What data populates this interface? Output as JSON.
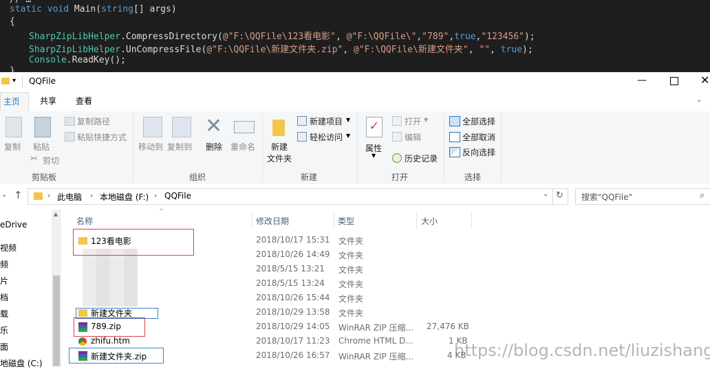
{
  "code": {
    "lines": [
      "static void Main(string[] args)",
      "{",
      "SharpZipLibHelper.CompressDirectory(@\"F:\\QQFile\\123看电影\", @\"F:\\QQFile\\\",\"789\",true,\"123456\");",
      "SharpZipLibHelper.UnCompressFile(@\"F:\\QQFile\\新建文件夹.zip\", @\"F:\\QQFile\\新建文件夹\", \"\", true);",
      "Console.ReadKey();"
    ]
  },
  "window": {
    "title": "QQFile"
  },
  "tabs": [
    "主页",
    "共享",
    "查看"
  ],
  "ribbon": {
    "clipboard": {
      "copy": "复制",
      "paste": "粘贴",
      "copy_path": "复制路径",
      "paste_shortcut": "粘贴快捷方式",
      "cut": "剪切",
      "group": "剪贴板"
    },
    "organize": {
      "move_to": "移动到",
      "copy_to": "复制到",
      "delete": "删除",
      "rename": "重命名",
      "group": "组织"
    },
    "new": {
      "new_folder_1": "新建",
      "new_folder_2": "文件夹",
      "new_item": "新建项目",
      "easy_access": "轻松访问",
      "group": "新建"
    },
    "open": {
      "properties": "属性",
      "open": "打开",
      "edit": "编辑",
      "history": "历史记录",
      "group": "打开"
    },
    "select": {
      "select_all": "全部选择",
      "select_none": "全部取消",
      "invert": "反向选择",
      "group": "选择"
    }
  },
  "address": {
    "crumbs": [
      "此电脑",
      "本地磁盘 (F:)",
      "QQFile"
    ],
    "search_placeholder": "搜索\"QQFile\""
  },
  "nav": [
    "eDrive",
    "视频",
    "频",
    "片",
    "档",
    "载",
    "乐",
    "面",
    "地磁盘 (C:)"
  ],
  "columns": {
    "name": "名称",
    "modified": "修改日期",
    "type": "类型",
    "size": "大小"
  },
  "files": [
    {
      "name": "123看电影",
      "date": "2018/10/17 15:31",
      "type": "文件夹",
      "size": ""
    },
    {
      "name": "",
      "date": "2018/10/26 14:49",
      "type": "文件夹",
      "size": ""
    },
    {
      "name": "",
      "date": "2018/5/15 13:21",
      "type": "文件夹",
      "size": ""
    },
    {
      "name": "",
      "date": "2018/5/15 13:24",
      "type": "文件夹",
      "size": ""
    },
    {
      "name": "",
      "date": "2018/10/26 15:44",
      "type": "文件夹",
      "size": ""
    },
    {
      "name": "新建文件夹",
      "date": "2018/10/29 13:58",
      "type": "文件夹",
      "size": ""
    },
    {
      "name": "789.zip",
      "date": "2018/10/29 14:05",
      "type": "WinRAR ZIP 压缩...",
      "size": "27,476 KB"
    },
    {
      "name": "zhifu.htm",
      "date": "2018/10/17 11:23",
      "type": "Chrome HTML D...",
      "size": "1 KB"
    },
    {
      "name": "新建文件夹.zip",
      "date": "2018/10/26 16:57",
      "type": "WinRAR ZIP 压缩...",
      "size": "4 KB"
    }
  ],
  "watermark": "https://blog.csdn.net/liuzishang",
  "colors": {
    "folder": "#f3c64b",
    "accent": "#1979ca",
    "highlight_red": "#d9414a",
    "highlight_blue": "#3a7fd5"
  }
}
